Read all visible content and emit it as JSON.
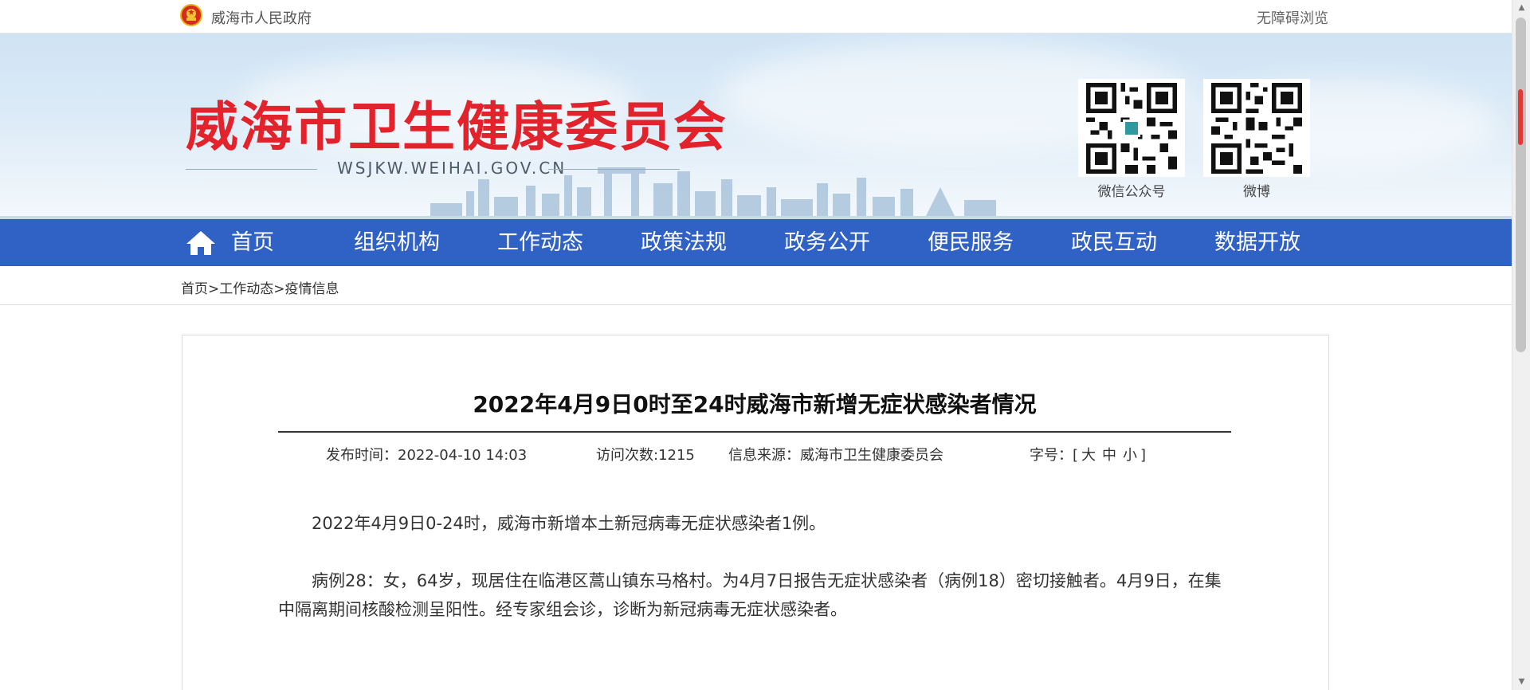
{
  "top_bar": {
    "gov_name": "威海市人民政府",
    "accessibility": "无障碍浏览"
  },
  "header": {
    "site_title": "威海市卫生健康委员会",
    "domain": "WSJKW.WEIHAI.GOV.CN",
    "qr_codes": [
      {
        "caption": "微信公众号",
        "icon": "wechat-qr-code"
      },
      {
        "caption": "微博",
        "icon": "weibo-qr-code"
      }
    ]
  },
  "nav": {
    "home_icon": "home-icon",
    "items": [
      "首页",
      "组织机构",
      "工作动态",
      "政策法规",
      "政务公开",
      "便民服务",
      "政民互动",
      "数据开放"
    ]
  },
  "breadcrumb": {
    "items": [
      "首页",
      "工作动态",
      "疫情信息"
    ],
    "separator": ">"
  },
  "article": {
    "title": "2022年4月9日0时至24时威海市新增无症状感染者情况",
    "meta": {
      "publish_label": "发布时间：",
      "publish_time": "2022-04-10 14:03",
      "visits_label": "访问次数:",
      "visits": "1215",
      "source_label": "信息来源：",
      "source": "威海市卫生健康委员会",
      "font_label": "字号：",
      "font_open": "[",
      "font_large": "大",
      "font_medium": "中",
      "font_small": "小",
      "font_close": "]"
    },
    "paragraphs": [
      "2022年4月9日0-24时，威海市新增本土新冠病毒无症状感染者1例。",
      "病例28：女，64岁，现居住在临港区蒿山镇东马格村。为4月7日报告无症状感染者（病例18）密切接触者。4月9日，在集中隔离期间核酸检测呈阳性。经专家组会诊，诊断为新冠病毒无症状感染者。"
    ]
  },
  "colors": {
    "title_red": "#e2232b",
    "nav_blue": "#3061c4"
  }
}
